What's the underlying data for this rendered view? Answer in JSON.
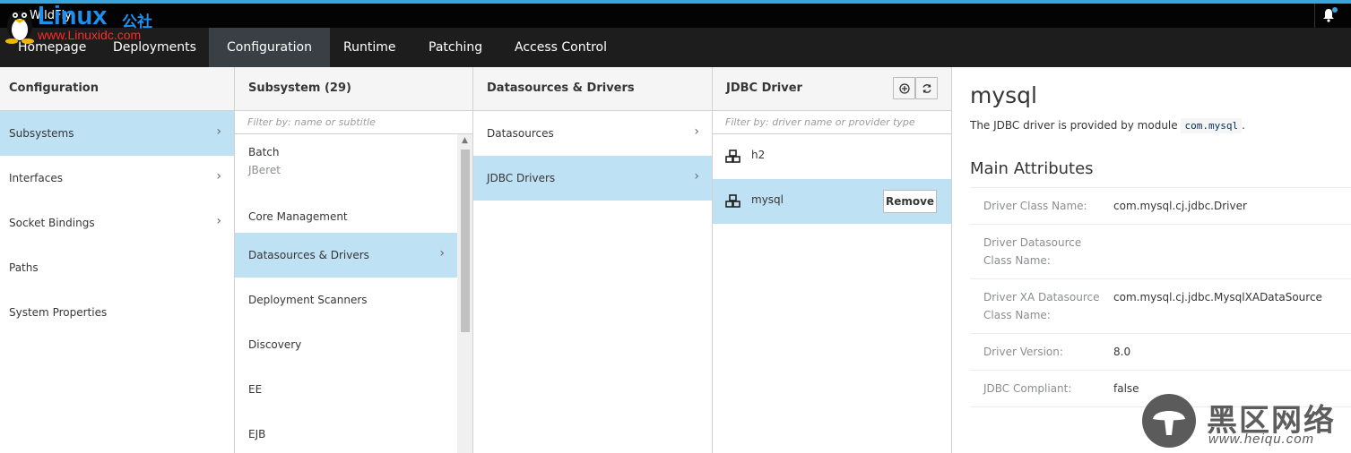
{
  "brand": {
    "name": "WildFly",
    "logo_text": "Linux",
    "logo_cn": "公社",
    "logo_url": "www.Linuxidc.com"
  },
  "nav": {
    "tabs": [
      {
        "label": "Homepage"
      },
      {
        "label": "Deployments"
      },
      {
        "label": "Configuration"
      },
      {
        "label": "Runtime"
      },
      {
        "label": "Patching"
      },
      {
        "label": "Access Control"
      }
    ],
    "active": "Configuration"
  },
  "col1": {
    "title": "Configuration",
    "items": [
      {
        "label": "Subsystems"
      },
      {
        "label": "Interfaces"
      },
      {
        "label": "Socket Bindings"
      },
      {
        "label": "Paths"
      },
      {
        "label": "System Properties"
      }
    ]
  },
  "col2": {
    "title": "Subsystem (29)",
    "filter_placeholder": "Filter by: name or subtitle",
    "items": [
      {
        "label": "Batch",
        "subtitle": "JBeret"
      },
      {
        "label": "Core Management"
      },
      {
        "label": "Datasources & Drivers"
      },
      {
        "label": "Deployment Scanners"
      },
      {
        "label": "Discovery"
      },
      {
        "label": "EE"
      },
      {
        "label": "EJB"
      }
    ]
  },
  "col3": {
    "title": "Datasources & Drivers",
    "items": [
      {
        "label": "Datasources"
      },
      {
        "label": "JDBC Drivers"
      }
    ]
  },
  "col4": {
    "title": "JDBC Driver",
    "filter_placeholder": "Filter by: driver name or provider type",
    "items": [
      {
        "label": "h2"
      },
      {
        "label": "mysql"
      }
    ],
    "remove_label": "Remove"
  },
  "details": {
    "title": "mysql",
    "desc_prefix": "The JDBC driver is provided by module",
    "module": "com.mysql",
    "desc_suffix": ".",
    "section": "Main Attributes",
    "attributes": [
      {
        "key": "Driver Class Name:",
        "value": "com.mysql.cj.jdbc.Driver"
      },
      {
        "key": "Driver Datasource Class Name:",
        "value": ""
      },
      {
        "key": "Driver XA Datasource Class Name:",
        "value": "com.mysql.cj.jdbc.MysqlXADataSource"
      },
      {
        "key": "Driver Version:",
        "value": "8.0"
      },
      {
        "key": "JDBC Compliant:",
        "value": "false"
      }
    ]
  },
  "watermark": {
    "text": "黑区网络",
    "url": "www.heiqu.com"
  },
  "colors": {
    "accent": "#39a5dc",
    "selected": "#bee1f4",
    "nav_bg": "#1d1d1d",
    "active_tab": "#393f44"
  }
}
